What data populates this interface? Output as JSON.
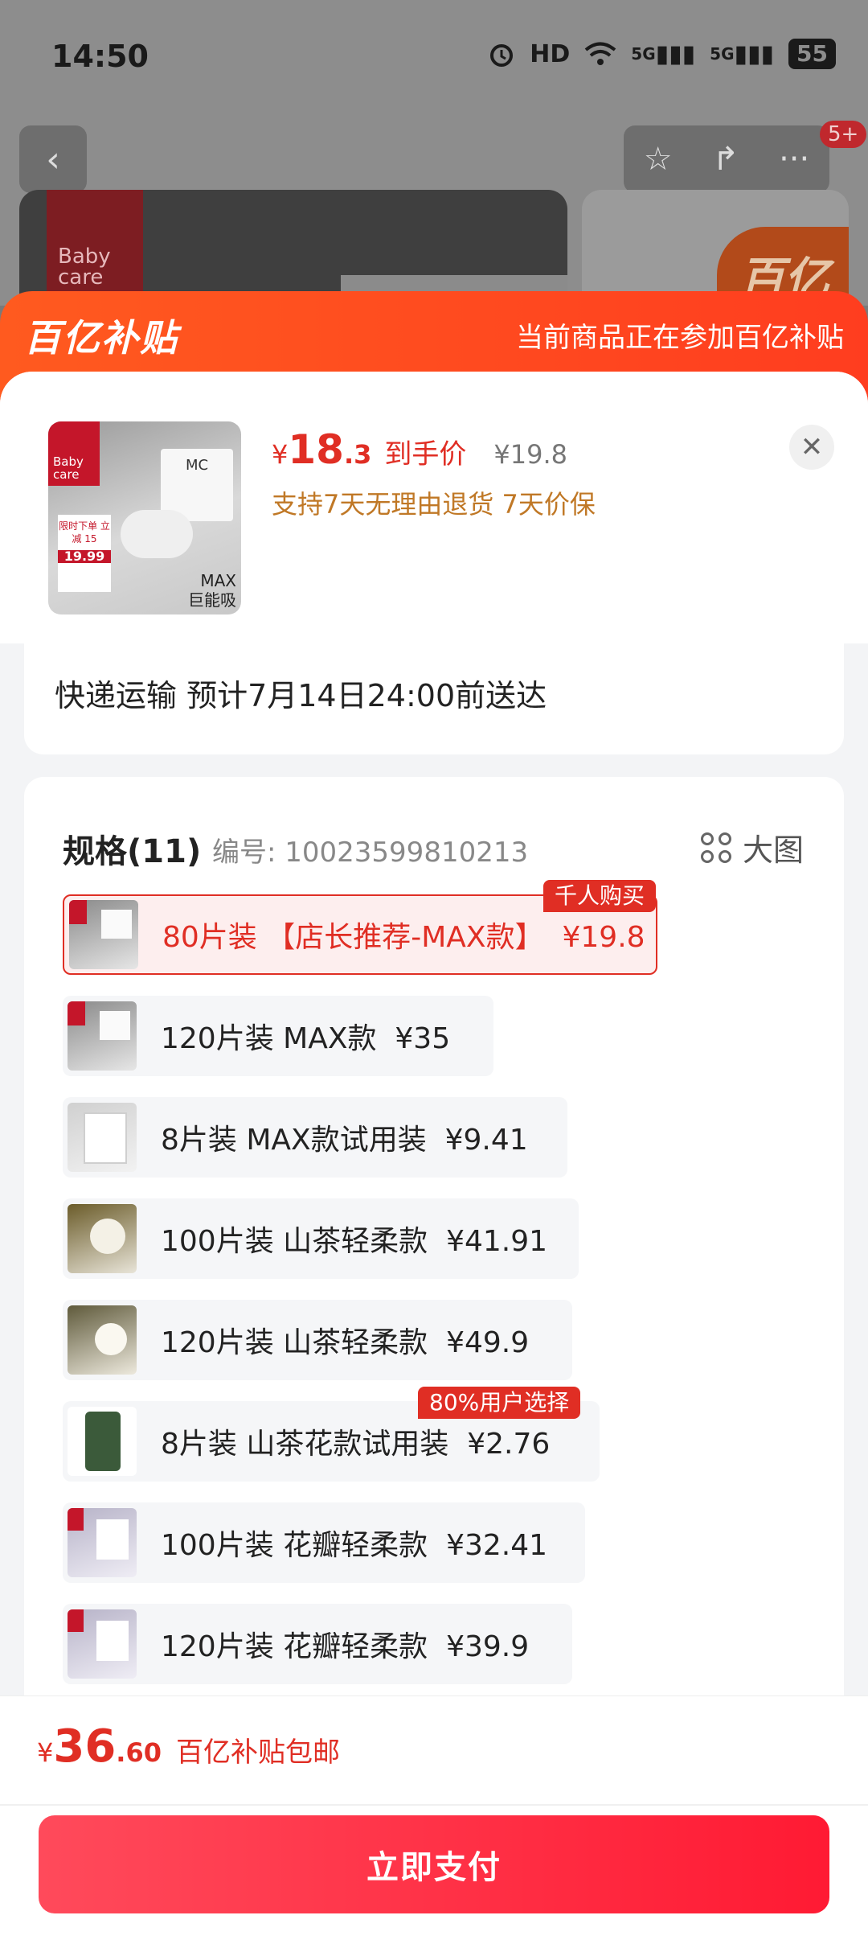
{
  "status_bar": {
    "time": "14:50",
    "hd_label": "HD",
    "sim1_label": "5G",
    "sim2_label": "5G",
    "battery": "55"
  },
  "nav": {
    "badge": "5+"
  },
  "background": {
    "brand_logo": "Baby care",
    "tag_logo": "百亿"
  },
  "banner": {
    "logo": "百亿补贴",
    "text": "当前商品正在参加百亿补贴"
  },
  "product": {
    "price_symbol": "¥",
    "price_int": "18",
    "price_dec": ".3",
    "price_label": "到手价",
    "original_price": "¥19.8",
    "guarantee": "支持7天无理由退货  7天价保",
    "thumb": {
      "brand": "Baby care",
      "box_label": "MC",
      "promo_line1": "限时下单 立减 15",
      "promo_price": "19.99",
      "max_line1": "MAX",
      "max_line2": "巨能吸"
    }
  },
  "shipping": {
    "text": "快递运输  预计7月14日24:00前送达"
  },
  "spec": {
    "title": "规格(11)",
    "code": "编号: 10023599810213",
    "big_image": "大图",
    "options": [
      {
        "label": "80片装 【店长推荐-MAX款】",
        "price": "¥19.8",
        "badge": "千人购买",
        "selected": true
      },
      {
        "label": "120片装 MAX款",
        "price": "¥35"
      },
      {
        "label": "8片装 MAX款试用装",
        "price": "¥9.41"
      },
      {
        "label": "100片装 山茶轻柔款",
        "price": "¥41.91"
      },
      {
        "label": "120片装 山茶轻柔款",
        "price": "¥49.9"
      },
      {
        "label": "8片装 山茶花款试用装",
        "price": "¥2.76",
        "badge": "80%用户选择"
      },
      {
        "label": "100片装 花瓣轻柔款",
        "price": "¥32.41"
      },
      {
        "label": "120片装 花瓣轻柔款",
        "price": "¥39.9"
      }
    ]
  },
  "footer": {
    "total_symbol": "¥",
    "total_int": "36",
    "total_dec": ".60",
    "total_label": "百亿补贴包邮",
    "pay_button": "立即支付"
  },
  "colors": {
    "accent": "#e02e24",
    "banner": "#ff4a1f",
    "guarantee": "#c07826",
    "pay_button": "#ff1a33"
  }
}
